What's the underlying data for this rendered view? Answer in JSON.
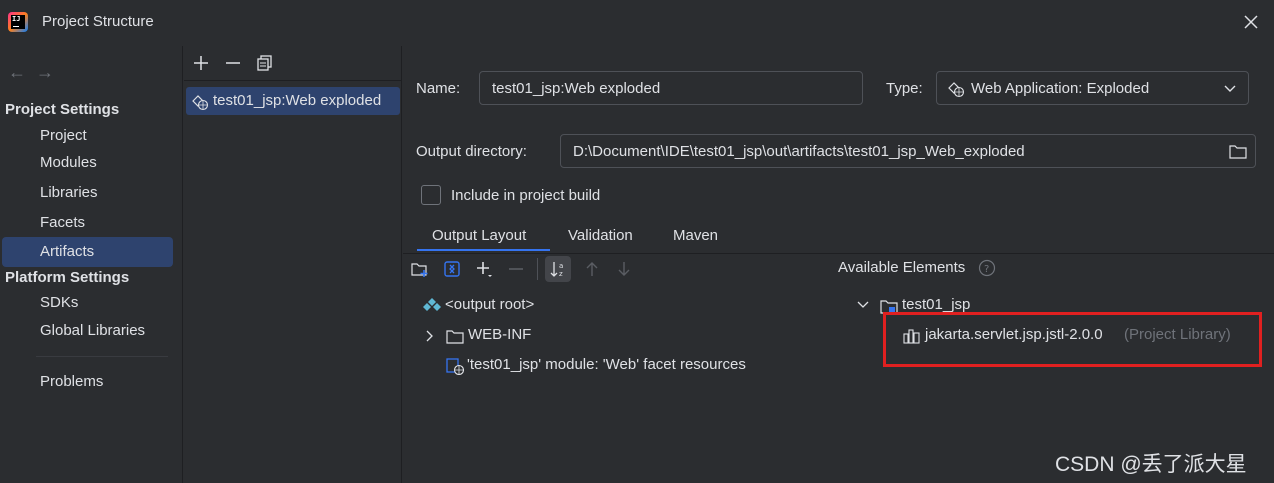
{
  "window": {
    "title": "Project Structure",
    "close_icon": "close-icon"
  },
  "nav": {
    "back_icon": "arrow-left-icon",
    "forward_icon": "arrow-right-icon",
    "project_settings_header": "Project Settings",
    "project_settings_items": [
      "Project",
      "Modules",
      "Libraries",
      "Facets",
      "Artifacts"
    ],
    "selected_item": "Artifacts",
    "platform_settings_header": "Platform Settings",
    "platform_settings_items": [
      "SDKs",
      "Global Libraries"
    ],
    "problems": "Problems"
  },
  "artifacts": {
    "toolbar": [
      "add-icon",
      "remove-icon",
      "copy-icon"
    ],
    "items": [
      "test01_jsp:Web exploded"
    ]
  },
  "form": {
    "name_label": "Name:",
    "name_value": "test01_jsp:Web exploded",
    "type_label": "Type:",
    "type_value": "Web Application: Exploded",
    "output_dir_label": "Output directory:",
    "output_dir_value": "D:\\Document\\IDE\\test01_jsp\\out\\artifacts\\test01_jsp_Web_exploded",
    "include_build_label": "Include in project build",
    "include_build_checked": false
  },
  "tabs": [
    "Output Layout",
    "Validation",
    "Maven"
  ],
  "active_tab": "Output Layout",
  "output_tree": {
    "root": "<output root>",
    "web_inf": "WEB-INF",
    "facet_resources": "'test01_jsp' module: 'Web' facet resources"
  },
  "available": {
    "label": "Available Elements",
    "module": "test01_jsp",
    "library_name": "jakarta.servlet.jsp.jstl-2.0.0",
    "library_kind": "(Project Library)"
  },
  "watermark": "CSDN @丢了派大星",
  "colors": {
    "accent": "#3574f0",
    "selection": "#2e436e",
    "highlight_border": "#e02020",
    "background": "#2b2d30"
  }
}
